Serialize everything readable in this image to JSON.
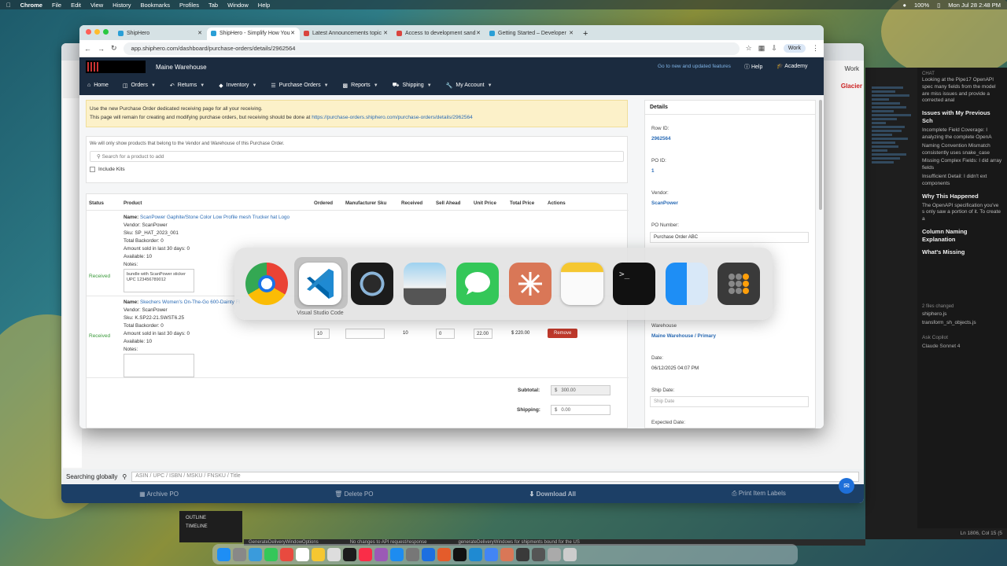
{
  "menubar": {
    "app": "Chrome",
    "items": [
      "File",
      "Edit",
      "View",
      "History",
      "Bookmarks",
      "Profiles",
      "Tab",
      "Window",
      "Help"
    ],
    "battery": "100%",
    "datetime": "Mon Jul 28  2:48 PM"
  },
  "browser": {
    "tabs": [
      {
        "title": "ShipHero",
        "active": false
      },
      {
        "title": "ShipHero - Simplify How You",
        "active": true
      },
      {
        "title": "Latest Announcements topic",
        "active": false
      },
      {
        "title": "Access to development sand",
        "active": false
      },
      {
        "title": "Getting Started – Developer",
        "active": false
      }
    ],
    "new_tab": "+",
    "url": "app.shiphero.com/dashboard/purchase-orders/details/2962564",
    "profile": "Work"
  },
  "header": {
    "warehouse": "Maine Warehouse",
    "news_link": "Go to new and updated features",
    "help": "Help",
    "academy": "Academy",
    "nav": [
      "Home",
      "Orders",
      "Returns",
      "Inventory",
      "Purchase Orders",
      "Reports",
      "Shipping",
      "My Account"
    ]
  },
  "notice": {
    "line1": "Use the new Purchase Order dedicated receiving page for all your receiving.",
    "line2": "This page will remain for creating and modifying purchase orders, but receiving should be done at",
    "link": "https://purchase-orders.shiphero.com/purchase-orders/details/2962564"
  },
  "products_panel": {
    "info": "We will only show products that belong to the Vendor and Warehouse of this Purchase Order.",
    "search_placeholder": "Search for a product to add",
    "include_kits": "Include Kits"
  },
  "table": {
    "headers": [
      "Status",
      "Product",
      "Ordered",
      "Manufacturer Sku",
      "Received",
      "Sell Ahead",
      "Unit Price",
      "Total Price",
      "Actions"
    ],
    "rows": [
      {
        "status": "Received",
        "name_label": "Name:",
        "name": "ScanPower Gaphite/Stone Color Low Profile mesh Trucker hat Logo",
        "vendor": "Vendor: ScanPower",
        "sku": "Sku: SP_HAT_2023_001",
        "backorder": "Total Backorder: 0",
        "sold30": "Amount sold in last 30 days: 0",
        "available": "Available: 10",
        "notes_label": "Notes:",
        "notes": "bundle with ScanPower sticker UPC 123456789012"
      },
      {
        "status": "Received",
        "name_label": "Name:",
        "name": "Skechers Women's On-The-Go 600-Dainty Fl",
        "vendor": "Vendor: ScanPower",
        "sku": "Sku: K.SP22-21.SWST6.25",
        "backorder": "Total Backorder: 0",
        "sold30": "Amount sold in last 30 days: 0",
        "available": "Available: 10",
        "notes_label": "Notes:",
        "notes": "",
        "ordered": "10",
        "manufacturer_sku": "",
        "received": "10",
        "sell_ahead": "0",
        "unit_price": "22.00",
        "total_price": "$ 220.00",
        "action": "Remove"
      }
    ],
    "subtotal_label": "Subtotal:",
    "subtotal": "300.00",
    "shipping_label": "Shipping:",
    "shipping": "0.00",
    "currency": "$"
  },
  "details": {
    "title": "Details",
    "row_id_label": "Row ID:",
    "row_id": "2962564",
    "po_id_label": "PO ID:",
    "po_id": "1",
    "vendor_label": "Vendor:",
    "vendor": "ScanPower",
    "po_number_label": "PO Number:",
    "po_number": "Purchase Order ABC",
    "warehouse_label": "Warehouse",
    "warehouse": "Maine Warehouse / Primary",
    "date_label": "Date:",
    "date": "06/12/2025 04:07 PM",
    "ship_date_label": "Ship Date:",
    "ship_date_placeholder": "Ship Date",
    "expected_date_label": "Expected Date:"
  },
  "app_switcher": {
    "apps": [
      "chrome-icon",
      "vscode-icon",
      "quicktime-icon",
      "preview-icon",
      "messages-icon",
      "claude-icon",
      "notes-icon",
      "terminal-icon",
      "finder-icon",
      "calculator-icon"
    ],
    "selected_label": "Visual Studio Code"
  },
  "back_window": {
    "profile": "Work",
    "glacier": "Glacier",
    "search_label": "Searching globally",
    "search_placeholder": "ASIN / UPC / ISBN / MSKU / FNSKU / Title",
    "archive": "Archive PO",
    "delete": "Delete PO",
    "download": "Download All",
    "print": "Print Item Labels"
  },
  "editor": {
    "chat_label": "CHAT",
    "intro": "Looking at the Pipe17 OpenAPI spec many fields from the model are miss issues and provide a corrected anal",
    "h1": "Issues with My Previous Sch",
    "issues": [
      "Incomplete Field Coverage: I analyzing the complete OpenA",
      "Naming Convention Mismatch consistently uses snake_case",
      "Missing Complex Fields: I did array fields",
      "Insufficient Detail: I didn't ext components"
    ],
    "h2": "Why This Happened",
    "why": "The OpenAPI specification you've s only saw a portion of it. To create a",
    "h3": "Column Naming Explanation",
    "h4": "What's Missing",
    "files_changed": "2 files changed",
    "files": [
      "shiphero.js",
      "transform_sh_objects.js"
    ],
    "ask": "Ask Copilot",
    "model": "Claude Sonnet 4",
    "status": "Ln 1806, Col 15 (5",
    "outline": "OUTLINE",
    "timeline": "TIMELINE",
    "bottom_status": [
      "GenerateDeliveryWindowOptions",
      "No changes to API request/response",
      "generateDeliveryWindows for shipments bound for the US"
    ]
  },
  "colors": {
    "header_bg": "#1b2b3f",
    "link": "#2a6bb5",
    "received": "#3a9a3a",
    "remove": "#c0392b",
    "notice_bg": "#fcf1c9"
  }
}
